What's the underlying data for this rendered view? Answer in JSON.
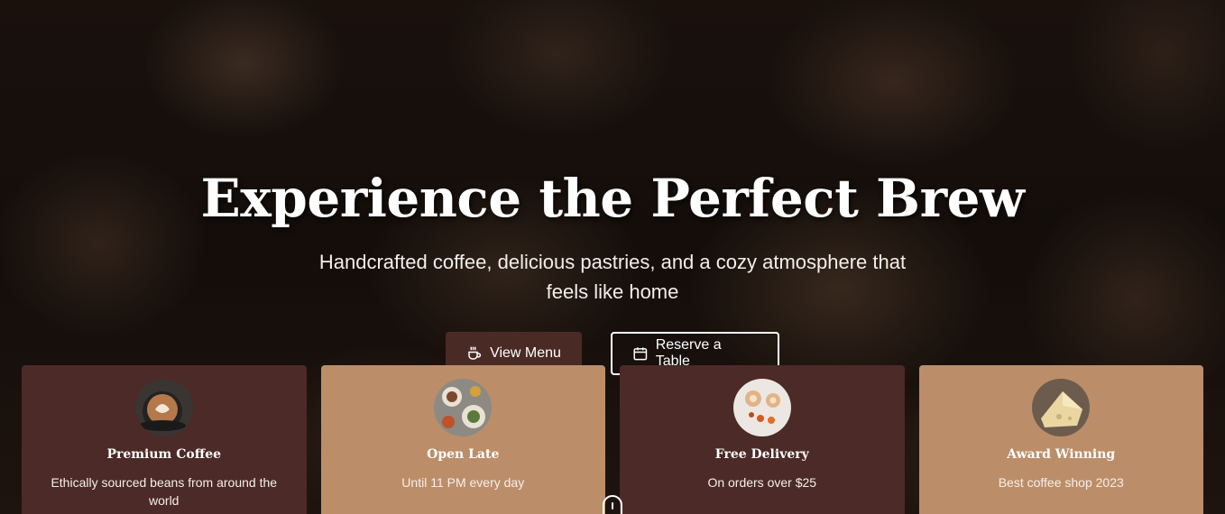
{
  "hero": {
    "title": "Experience the Perfect Brew",
    "subtitle": "Handcrafted coffee, delicious pastries, and a cozy atmosphere that feels like home",
    "primary_button": {
      "label": "View Menu",
      "icon": "coffee-cup-icon"
    },
    "secondary_button": {
      "label": "Reserve a Table",
      "icon": "calendar-icon"
    }
  },
  "features": [
    {
      "title": "Premium Coffee",
      "text": "Ethically sourced beans from around the world",
      "image": "latte-art-image",
      "theme": "dark"
    },
    {
      "title": "Open Late",
      "text": "Until 11 PM every day",
      "image": "food-table-image",
      "theme": "light"
    },
    {
      "title": "Free Delivery",
      "text": "On orders over $25",
      "image": "pastries-image",
      "theme": "dark"
    },
    {
      "title": "Award Winning",
      "text": "Best coffee shop 2023",
      "image": "cheese-image",
      "theme": "light"
    }
  ],
  "colors": {
    "primary": "#4b2a27",
    "accent": "#bb8e69"
  }
}
